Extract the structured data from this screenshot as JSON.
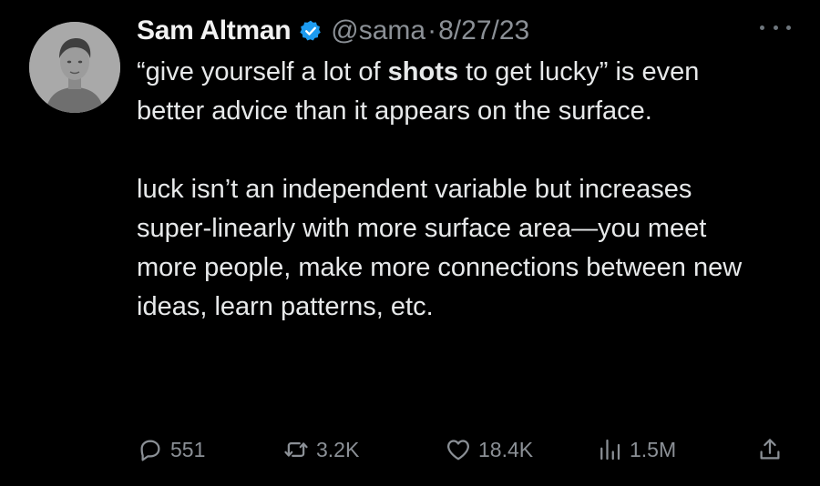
{
  "author": {
    "name": "Sam Altman",
    "handle": "@sama",
    "separator": "·",
    "date": "8/27/23"
  },
  "tweet": {
    "p1_before": "“give yourself a lot of ",
    "p1_bold": "shots",
    "p1_after": " to get lucky” is even better advice than it appears on the surface.",
    "p2": "luck isn’t an independent variable but increases super-linearly with more surface area—you meet more people, make more connections between new ideas, learn patterns, etc."
  },
  "stats": {
    "replies": "551",
    "retweets": "3.2K",
    "likes": "18.4K",
    "views": "1.5M"
  },
  "icons": {
    "avatar": "profile-photo",
    "verified": "verified-badge-icon",
    "more": "more-options-icon",
    "reply": "reply-icon",
    "retweet": "retweet-icon",
    "like": "heart-icon",
    "views": "views-chart-icon",
    "share": "share-icon"
  },
  "colors": {
    "background": "#000000",
    "text": "#e7e9ea",
    "muted": "#8b9096",
    "verified": "#1d9bf0"
  }
}
